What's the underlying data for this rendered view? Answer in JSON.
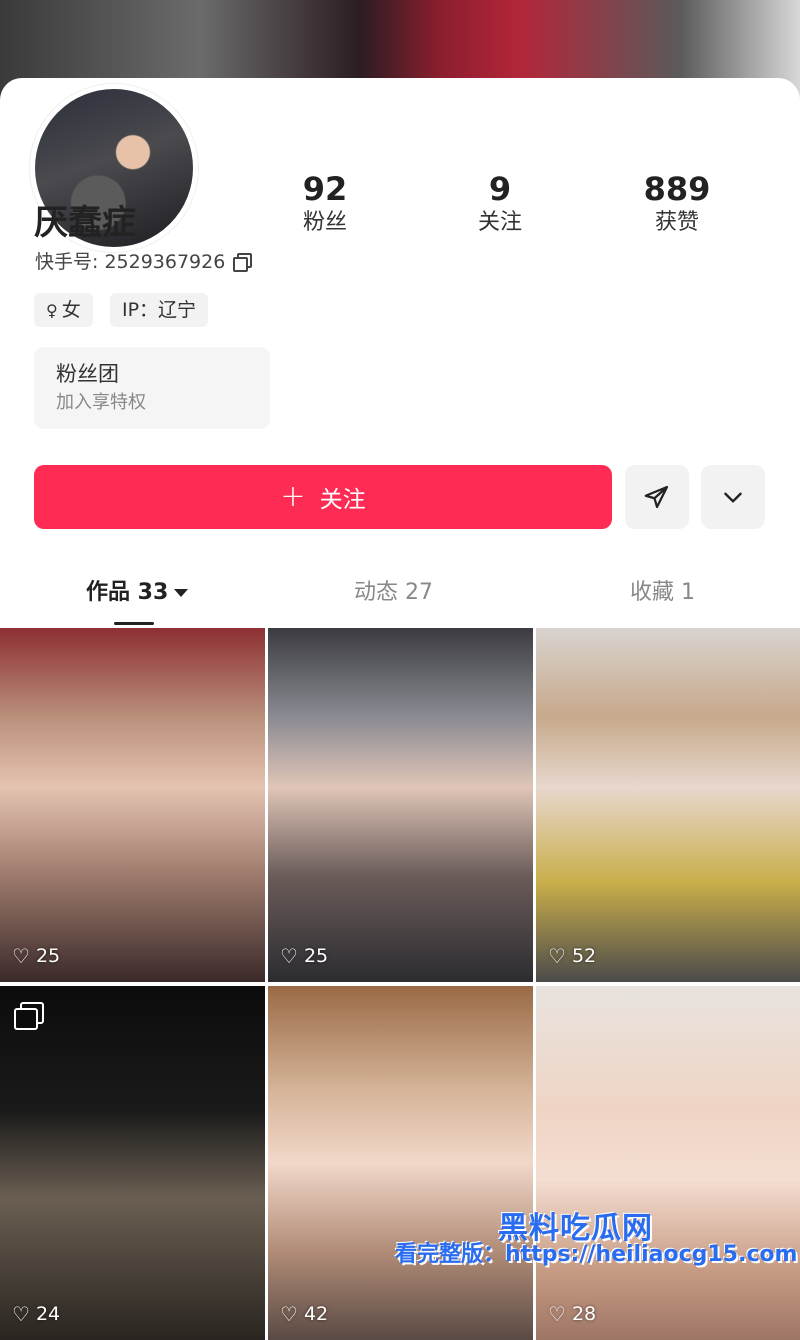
{
  "profile": {
    "name": "厌蠢症",
    "kuaishou_id": "快手号: 2529367926",
    "gender_tag": "女",
    "ip_tag": "IP：辽宁",
    "stats": [
      {
        "value": "92",
        "label": "粉丝"
      },
      {
        "value": "9",
        "label": "关注"
      },
      {
        "value": "889",
        "label": "获赞"
      }
    ]
  },
  "fan_group": {
    "title": "粉丝团",
    "subtitle": "加入享特权"
  },
  "actions": {
    "follow_label": "关注",
    "send_icon": "send-icon",
    "more_icon": "chevron-down-icon"
  },
  "tabs": [
    {
      "label": "作品 33",
      "active": true
    },
    {
      "label": "动态 27",
      "active": false
    },
    {
      "label": "收藏 1",
      "active": false
    }
  ],
  "posts": [
    {
      "likes": "25"
    },
    {
      "likes": "25"
    },
    {
      "likes": "52"
    },
    {
      "likes": "24",
      "icon": "multi-image-icon"
    },
    {
      "likes": "42"
    },
    {
      "likes": "28"
    }
  ],
  "watermark": {
    "brand": "黑料吃瓜网",
    "line": "看完整版：https://heiliaocg15.com"
  },
  "colors": {
    "accent": "#fe2c55"
  }
}
